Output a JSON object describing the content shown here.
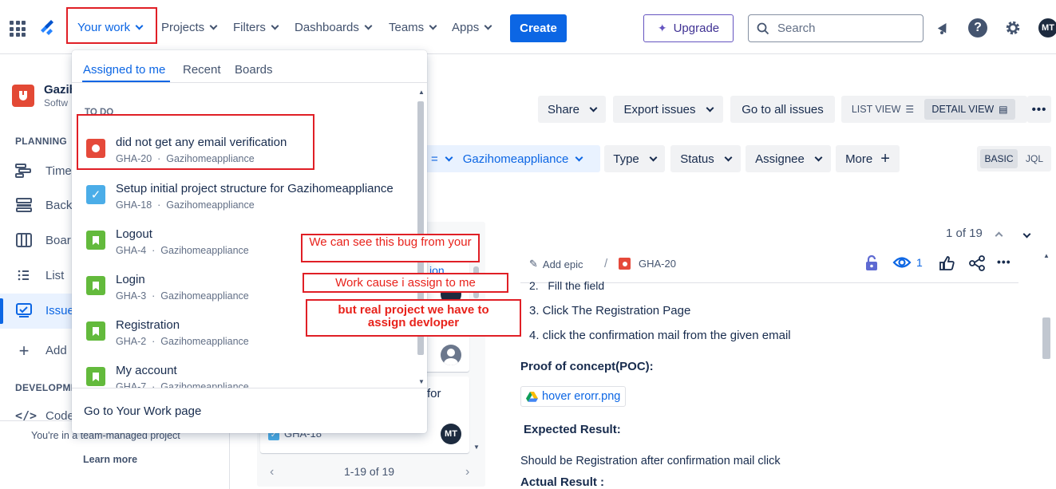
{
  "nav": {
    "your_work": "Your work",
    "projects": "Projects",
    "filters": "Filters",
    "dashboards": "Dashboards",
    "teams": "Teams",
    "apps": "Apps",
    "create": "Create",
    "upgrade": "Upgrade",
    "search_placeholder": "Search",
    "avatar": "MT"
  },
  "sidebar": {
    "project_name": "Gazih",
    "project_type": "Softw",
    "planning_heading": "PLANNING",
    "items": [
      "Time",
      "Back",
      "Boar",
      "List",
      "Issue"
    ],
    "add_label": "Add",
    "development_heading": "DEVELOPME",
    "code_label": "Code",
    "team_managed_text": "You're in a team-managed project",
    "learn_more": "Learn more"
  },
  "toolbar": {
    "share": "Share",
    "export": "Export issues",
    "go_all": "Go to all issues",
    "list_view": "LIST VIEW",
    "detail_view": "DETAIL VIEW"
  },
  "filters": {
    "eq": "=",
    "project": "Gazihomeappliance",
    "type": "Type",
    "status": "Status",
    "assignee": "Assignee",
    "more": "More",
    "basic": "BASIC",
    "jql": "JQL"
  },
  "dropdown": {
    "tabs": [
      "Assigned to me",
      "Recent",
      "Boards"
    ],
    "section": "TO DO",
    "items": [
      {
        "title": "did not get any email verification",
        "key": "GHA-20",
        "project": "Gazihomeappliance",
        "type": "bug"
      },
      {
        "title": "Setup initial project structure for Gazihomeappliance",
        "key": "GHA-18",
        "project": "Gazihomeappliance",
        "type": "task"
      },
      {
        "title": "Logout",
        "key": "GHA-4",
        "project": "Gazihomeappliance",
        "type": "story"
      },
      {
        "title": "Login",
        "key": "GHA-3",
        "project": "Gazihomeappliance",
        "type": "story"
      },
      {
        "title": "Registration",
        "key": "GHA-2",
        "project": "Gazihomeappliance",
        "type": "story"
      },
      {
        "title": "My account",
        "key": "GHA-7",
        "project": "Gazihomeappliance",
        "type": "story"
      }
    ],
    "footer": "Go to Your Work page"
  },
  "issue_list": {
    "partial_1": "ion",
    "partial_for": "for",
    "row_key": "GHA-18",
    "avatar": "MT",
    "pagination": "1-19 of 19"
  },
  "detail": {
    "counter": "1 of 19",
    "add_epic": "Add epic",
    "separator": "/",
    "issue_key": "GHA-20",
    "watchers": "1",
    "steps": [
      "2.   Fill the field",
      "3. Click The Registration Page",
      "4. click the confirmation mail from the given email"
    ],
    "poc_heading": "Proof of concept(POC):",
    "attachment": "hover erorr.png",
    "expected_heading": "Expected Result:",
    "expected_text": "Should be Registration after confirmation mail click",
    "actual_heading": "Actual Result :"
  },
  "annotations": {
    "note1": "We can see this bug from your",
    "note2": "Work cause i assign to me",
    "note3": "but real project we have to assign devloper"
  },
  "colors": {
    "brand_blue": "#0c66e4",
    "annotation_red": "#e01f26",
    "bug_red": "#e5493a",
    "task_blue": "#4bade8",
    "story_green": "#63ba3c"
  }
}
